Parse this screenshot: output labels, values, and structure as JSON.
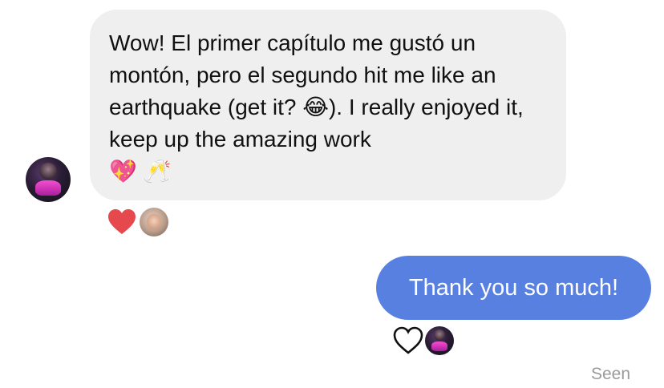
{
  "conversation": {
    "incoming": {
      "sender_avatar_icon": "user-avatar-icon",
      "text": "Wow! El primer capítulo me gustó un montón, pero el segundo hit me like an earthquake (get it? 😂). I really enjoyed it, keep up the amazing work",
      "emoji_line": "💖 🥂",
      "bubble_color": "#efefef",
      "reactions": {
        "heart_icon": "heart-filled-icon",
        "heart_color": "#e5484d",
        "reactor_avatar_icon": "reactor-avatar-icon"
      }
    },
    "outgoing": {
      "text": "Thank you so much!",
      "bubble_color": "#5780e0",
      "reactions": {
        "heart_icon": "heart-outline-icon",
        "reactor_avatar_icon": "reactor-avatar-icon"
      }
    },
    "seen_label": "Seen"
  }
}
